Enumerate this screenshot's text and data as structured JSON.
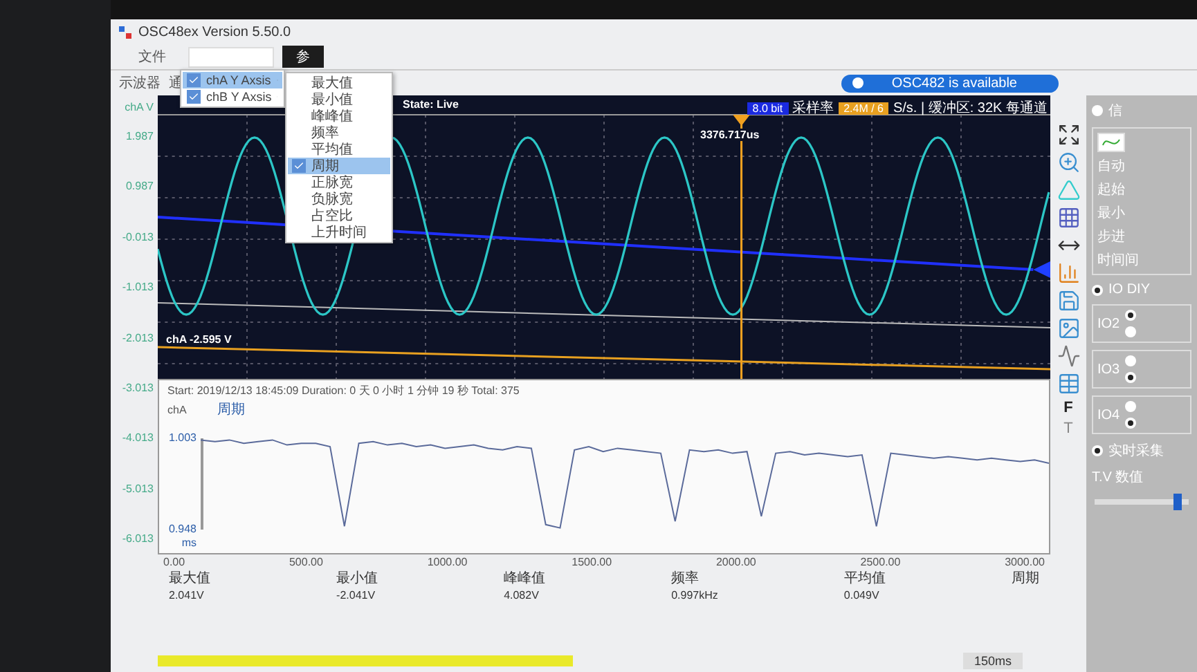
{
  "window": {
    "title": "OSC48ex Version 5.50.0"
  },
  "menu_bar": [
    {
      "label": "文件",
      "selected": false
    },
    {
      "label": "参",
      "selected": true
    }
  ],
  "side_labels": [
    "示波器",
    "通"
  ],
  "dropdown": {
    "items": [
      {
        "label": "chA Y Axsis",
        "checked": true,
        "selected": true
      },
      {
        "label": "chB Y Axsis",
        "checked": true,
        "selected": false
      }
    ],
    "submenu": [
      {
        "label": "最大值",
        "checked": false,
        "selected": false
      },
      {
        "label": "最小值",
        "checked": false,
        "selected": false
      },
      {
        "label": "峰峰值",
        "checked": false,
        "selected": false
      },
      {
        "label": "频率",
        "checked": false,
        "selected": false
      },
      {
        "label": "平均值",
        "checked": false,
        "selected": false
      },
      {
        "label": "周期",
        "checked": true,
        "selected": true
      },
      {
        "label": "正脉宽",
        "checked": false,
        "selected": false
      },
      {
        "label": "负脉宽",
        "checked": false,
        "selected": false
      },
      {
        "label": "占空比",
        "checked": false,
        "selected": false
      },
      {
        "label": "上升时间",
        "checked": false,
        "selected": false
      }
    ]
  },
  "scope": {
    "axis_label": "chA V",
    "yticks": [
      "1.987",
      "0.987",
      "-0.013",
      "-1.013",
      "-2.013",
      "-3.013",
      "-4.013",
      "-5.013",
      "-6.013"
    ],
    "state": "State: Live",
    "device_status": "OSC482  is available",
    "bits": "8.0 bit",
    "sample_label": "采样率",
    "sample_rate": "2.4M / 6",
    "buffer": "S/s. | 缓冲区: 32K 每通道",
    "cursor_time": "3376.717us",
    "channel_reading": "chA -2.595 V"
  },
  "trend": {
    "summary": "Start: 2019/12/13 18:45:09  Duration: 0 天 0 小时 1 分钟 19 秒  Total: 375",
    "channel": "chA",
    "unit": "ms",
    "xticks": [
      "0.00",
      "500.00",
      "1000.00",
      "1500.00",
      "2000.00",
      "2500.00",
      "3000.00"
    ],
    "chart_data": {
      "type": "line",
      "ylim": [
        0.948,
        1.003
      ],
      "yticks": [
        {
          "value": 1.003,
          "label": "1.003"
        },
        {
          "value": 0.948,
          "label": "0.948"
        }
      ],
      "categories": [
        null,
        null,
        null,
        null,
        null,
        null,
        null,
        null,
        null,
        null,
        null,
        null,
        null,
        null,
        null,
        null,
        null,
        null,
        null,
        null,
        null,
        null,
        null,
        null,
        null,
        null,
        null,
        null,
        null,
        null,
        null,
        null,
        null,
        null,
        null,
        null,
        null,
        null,
        null,
        null,
        null,
        null,
        null,
        null,
        null,
        null,
        null,
        null,
        null,
        null,
        null,
        null,
        null,
        null,
        null,
        null,
        null,
        null,
        null,
        null
      ],
      "series": [
        {
          "name": "周期",
          "color": "#5a6a9a",
          "values": [
            1.002,
            1.001,
            1.002,
            1.0,
            1.001,
            1.002,
            0.999,
            1.0,
            1.0,
            0.998,
            0.95,
            1.0,
            1.001,
            0.999,
            1.0,
            0.998,
            0.999,
            0.997,
            0.998,
            0.999,
            0.997,
            0.996,
            0.998,
            0.997,
            0.951,
            0.949,
            0.996,
            0.998,
            0.995,
            0.997,
            0.996,
            0.995,
            0.994,
            0.953,
            0.996,
            0.995,
            0.996,
            0.994,
            0.995,
            0.956,
            0.994,
            0.995,
            0.993,
            0.994,
            0.993,
            0.992,
            0.993,
            0.95,
            0.994,
            0.993,
            0.992,
            0.991,
            0.992,
            0.991,
            0.99,
            0.991,
            0.99,
            0.989,
            0.99,
            0.988
          ]
        }
      ]
    }
  },
  "measurements": [
    {
      "label": "最大值",
      "value": "2.041V"
    },
    {
      "label": "最小值",
      "value": "-2.041V"
    },
    {
      "label": "峰峰值",
      "value": "4.082V"
    },
    {
      "label": "频率",
      "value": "0.997kHz"
    },
    {
      "label": "平均值",
      "value": "0.049V"
    },
    {
      "label": "周期"
    }
  ],
  "footer_reading": "150ms",
  "toolbar_letters": [
    "F",
    "T"
  ],
  "side_panel": {
    "top_radio": {
      "label": "信",
      "checked": false
    },
    "settings": [
      "自动",
      "起始",
      "最小",
      "步进",
      "时间间"
    ],
    "io_radio": {
      "label": "IO DIY",
      "checked": true
    },
    "io_groups": [
      {
        "label": "IO2",
        "options": [
          {
            "checked": true
          },
          {
            "checked": false
          }
        ]
      },
      {
        "label": "IO3",
        "options": [
          {
            "checked": false
          },
          {
            "checked": true
          }
        ]
      },
      {
        "label": "IO4",
        "options": [
          {
            "checked": false
          },
          {
            "checked": true
          }
        ]
      }
    ],
    "capture_radio": {
      "label": "实时采集",
      "checked": true
    },
    "slider_label": "T.V 数值",
    "slider": {
      "level": 0.88
    }
  }
}
